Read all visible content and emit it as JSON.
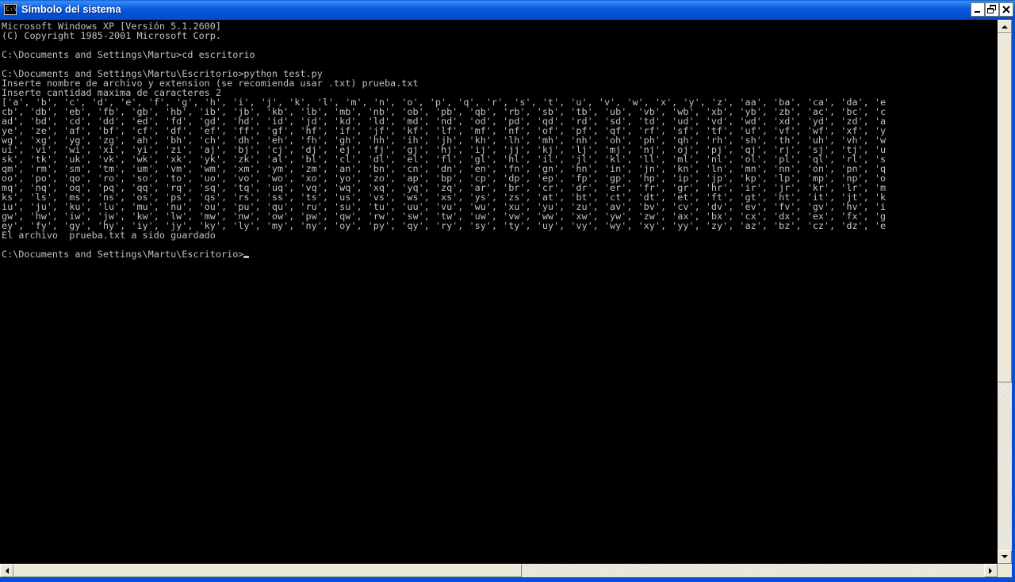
{
  "window": {
    "title": "Símbolo del sistema",
    "icon_glyph": "C:\\"
  },
  "console": {
    "lines": [
      "Microsoft Windows XP [Versión 5.1.2600]",
      "(C) Copyright 1985-2001 Microsoft Corp.",
      "",
      "C:\\Documents and Settings\\Martu>cd escritorio",
      "",
      "C:\\Documents and Settings\\Martu\\Escritorio>python test.py",
      "Inserte nombre de archivo y extension (se recomienda usar .txt) prueba.txt",
      "Inserte cantidad maxima de caracteres 2",
      "['a', 'b', 'c', 'd', 'e', 'f', 'g', 'h', 'i', 'j', 'k', 'l', 'm', 'n', 'o', 'p', 'q', 'r', 's', 't', 'u', 'v', 'w', 'x', 'y', 'z', 'aa', 'ba', 'ca', 'da', 'e",
      "cb', 'db', 'eb', 'fb', 'gb', 'hb', 'ib', 'jb', 'kb', 'lb', 'mb', 'nb', 'ob', 'pb', 'qb', 'rb', 'sb', 'tb', 'ub', 'vb', 'wb', 'xb', 'yb', 'zb', 'ac', 'bc', 'c",
      "ad', 'bd', 'cd', 'dd', 'ed', 'fd', 'gd', 'hd', 'id', 'jd', 'kd', 'ld', 'md', 'nd', 'od', 'pd', 'qd', 'rd', 'sd', 'td', 'ud', 'vd', 'wd', 'xd', 'yd', 'zd', 'a",
      "ye', 'ze', 'af', 'bf', 'cf', 'df', 'ef', 'ff', 'gf', 'hf', 'if', 'jf', 'kf', 'lf', 'mf', 'nf', 'of', 'pf', 'qf', 'rf', 'sf', 'tf', 'uf', 'vf', 'wf', 'xf', 'y",
      "wg', 'xg', 'yg', 'zg', 'ah', 'bh', 'ch', 'dh', 'eh', 'fh', 'gh', 'hh', 'ih', 'jh', 'kh', 'lh', 'mh', 'nh', 'oh', 'ph', 'qh', 'rh', 'sh', 'th', 'uh', 'vh', 'w",
      "ui', 'vi', 'wi', 'xi', 'yi', 'zi', 'aj', 'bj', 'cj', 'dj', 'ej', 'fj', 'gj', 'hj', 'ij', 'jj', 'kj', 'lj', 'mj', 'nj', 'oj', 'pj', 'qj', 'rj', 'sj', 'tj', 'u",
      "sk', 'tk', 'uk', 'vk', 'wk', 'xk', 'yk', 'zk', 'al', 'bl', 'cl', 'dl', 'el', 'fl', 'gl', 'hl', 'il', 'jl', 'kl', 'll', 'ml', 'nl', 'ol', 'pl', 'ql', 'rl', 's",
      "qm', 'rm', 'sm', 'tm', 'um', 'vm', 'wm', 'xm', 'ym', 'zm', 'an', 'bn', 'cn', 'dn', 'en', 'fn', 'gn', 'hn', 'in', 'jn', 'kn', 'ln', 'mn', 'nn', 'on', 'pn', 'q",
      "oo', 'po', 'qo', 'ro', 'so', 'to', 'uo', 'vo', 'wo', 'xo', 'yo', 'zo', 'ap', 'bp', 'cp', 'dp', 'ep', 'fp', 'gp', 'hp', 'ip', 'jp', 'kp', 'lp', 'mp', 'np', 'o",
      "mq', 'nq', 'oq', 'pq', 'qq', 'rq', 'sq', 'tq', 'uq', 'vq', 'wq', 'xq', 'yq', 'zq', 'ar', 'br', 'cr', 'dr', 'er', 'fr', 'gr', 'hr', 'ir', 'jr', 'kr', 'lr', 'm",
      "ks', 'ls', 'ms', 'ns', 'os', 'ps', 'qs', 'rs', 'ss', 'ts', 'us', 'vs', 'ws', 'xs', 'ys', 'zs', 'at', 'bt', 'ct', 'dt', 'et', 'ft', 'gt', 'ht', 'it', 'jt', 'k",
      "iu', 'ju', 'ku', 'lu', 'mu', 'nu', 'ou', 'pu', 'qu', 'ru', 'su', 'tu', 'uu', 'vu', 'wu', 'xu', 'yu', 'zu', 'av', 'bv', 'cv', 'dv', 'ev', 'fv', 'gv', 'hv', 'i",
      "gw', 'hw', 'iw', 'jw', 'kw', 'lw', 'mw', 'nw', 'ow', 'pw', 'qw', 'rw', 'sw', 'tw', 'uw', 'vw', 'ww', 'xw', 'yw', 'zw', 'ax', 'bx', 'cx', 'dx', 'ex', 'fx', 'g",
      "ey', 'fy', 'gy', 'hy', 'iy', 'jy', 'ky', 'ly', 'my', 'ny', 'oy', 'py', 'qy', 'ry', 'sy', 'ty', 'uy', 'vy', 'wy', 'xy', 'yy', 'zy', 'az', 'bz', 'cz', 'dz', 'e",
      "El archivo  prueba.txt a sido guardado",
      ""
    ],
    "prompt": "C:\\Documents and Settings\\Martu\\Escritorio>"
  },
  "icons": {
    "minimize": "minimize-icon",
    "maximize": "restore-icon",
    "close": "close-icon",
    "scroll_up": "scroll-up-arrow-icon",
    "scroll_down": "scroll-down-arrow-icon",
    "scroll_left": "scroll-left-arrow-icon",
    "scroll_right": "scroll-right-arrow-icon"
  },
  "colors": {
    "console_bg": "#000000",
    "console_fg": "#c0c0c0",
    "titlebar": "#0450d6",
    "close_button": "#e04b26"
  }
}
